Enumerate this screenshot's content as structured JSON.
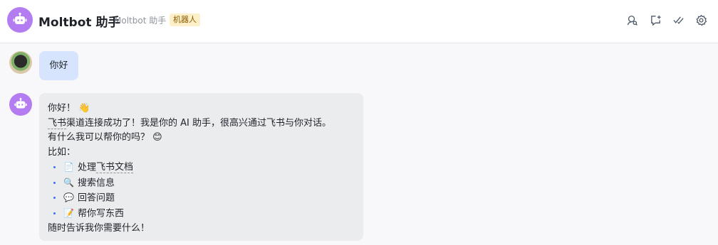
{
  "header": {
    "title": "Moltbot 助手",
    "subtitle": "Moltbot 助手",
    "badge": "机器人",
    "icons": [
      "profile-search-icon",
      "new-chat-icon",
      "checklist-icon",
      "settings-icon"
    ]
  },
  "colors": {
    "bot_avatar": "#b37cf0",
    "user_bubble": "#d6e4fe",
    "bot_bubble": "#ebecee",
    "bullet": "#3370ff",
    "badge_bg": "#fdf0c8"
  },
  "messages": {
    "user_text": "你好",
    "bot": {
      "greeting": "你好！",
      "greeting_emoji": "👋",
      "line2_link": "飞书",
      "line2_text": "渠道连接成功了！我是你的 AI 助手，很高兴通过飞书与你对话。",
      "line3": "有什么我可以帮你的吗？",
      "line3_emoji": "😊",
      "line4": "比如：",
      "items": [
        {
          "icon": "📄",
          "icon_name": "document-icon",
          "text": "处理",
          "link": "飞书文档"
        },
        {
          "icon": "🔍",
          "icon_name": "magnifier-icon",
          "text": "搜索信息",
          "link": ""
        },
        {
          "icon": "💬",
          "icon_name": "speech-bubble-icon",
          "text": "回答问题",
          "link": ""
        },
        {
          "icon": "📝",
          "icon_name": "memo-icon",
          "text": "帮你写东西",
          "link": ""
        }
      ],
      "closing": "随时告诉我你需要什么！"
    }
  }
}
